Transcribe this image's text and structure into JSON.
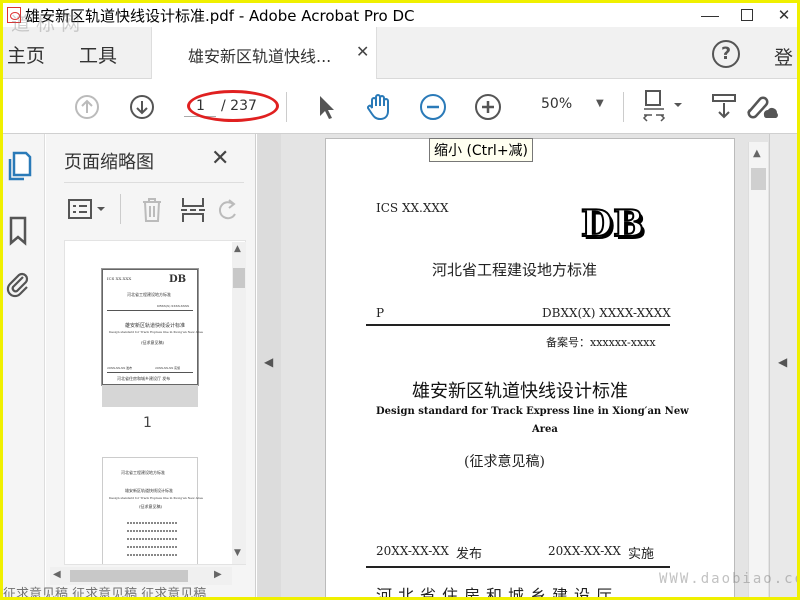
{
  "window": {
    "title": "雄安新区轨道快线设计标准.pdf - Adobe Acrobat Pro DC"
  },
  "tabs": {
    "home": "主页",
    "tools": "工具",
    "document": "雄安新区轨道快线...",
    "login": "登"
  },
  "toolbar": {
    "current_page": "1",
    "total_pages": "/ 237",
    "zoom": "50%",
    "tooltip": "缩小 (Ctrl+减)"
  },
  "panel": {
    "title": "页面缩略图",
    "thumb1_label": "1"
  },
  "thumb1": {
    "ics": "ICS XX.XXX",
    "db": "DB",
    "org": "河北省工程建设地方标准",
    "code": "DBXX(X) XXXX-XXXX",
    "title": "雄安新区轨道快线设计标准",
    "en": "Design standard for Track Express line in Xiong'an New Area",
    "draft": "(征求意见稿)",
    "issue": "20XX-XX-XX 发布",
    "impl": "20XX-XX-XX 实施",
    "publisher": "河北省住房和城乡建设厅 发布"
  },
  "thumb2": {
    "line1": "河北省工程建设地方标准",
    "line2": "雄安新区轨道快线设计标准",
    "line3": "Design standard for Track Express line in Xiong'an New Area",
    "line4": "(征求意见稿)"
  },
  "page": {
    "ics": "ICS XX.XXX",
    "db": "DB",
    "org": "河北省工程建设地方标准",
    "p": "P",
    "code": "DBXX(X) XXXX-XXXX",
    "record": "备案号：xxxxxx-xxxx",
    "title_cn": "雄安新区轨道快线设计标准",
    "title_en_1": "Design standard for Track Express line in Xiong′an New",
    "title_en_2": "Area",
    "draft": "(征求意见稿)",
    "issue_date": "20XX-XX-XX",
    "issue_label": "发布",
    "impl_date": "20XX-XX-XX",
    "impl_label": "实施",
    "publisher": "河北省住房和城乡建设厅"
  },
  "watermarks": {
    "top_left": "道 标 网",
    "bottom_right": "WWW.daobiao.com",
    "bottom": "征求意见稿 征求意见稿 征求意见稿"
  },
  "colors": {
    "accent_blue": "#2a7ab8",
    "annotation_red": "#e02020",
    "page_bg": "#e4e4e4"
  }
}
